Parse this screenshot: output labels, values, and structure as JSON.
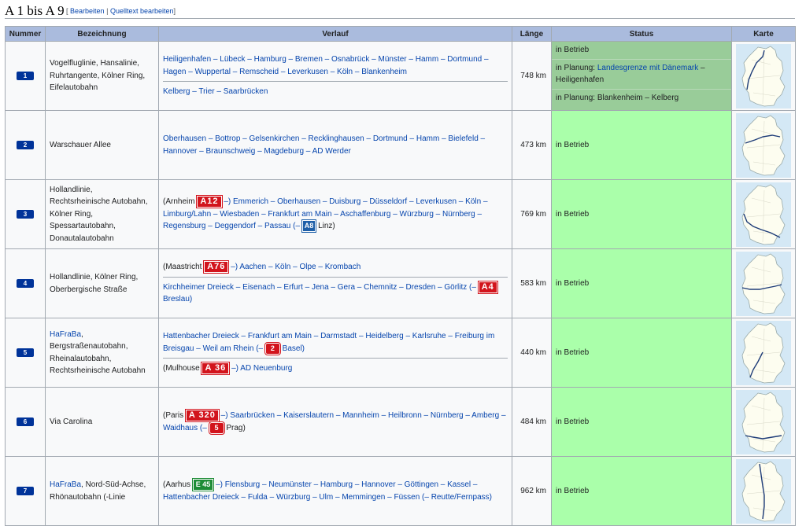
{
  "heading": {
    "title": "A 1 bis A 9",
    "edit_open": "[",
    "edit_label": "Bearbeiten",
    "edit_sep": "|",
    "source_label": "Quelltext bearbeiten",
    "edit_close": "]"
  },
  "columns": {
    "nummer": "Nummer",
    "bezeichnung": "Bezeichnung",
    "verlauf": "Verlauf",
    "laenge": "Länge",
    "status": "Status",
    "karte": "Karte"
  },
  "rows": [
    {
      "nummer": "1",
      "bezeichnung": "Vogelfluglinie, Hansalinie, Ruhrtangente, Kölner Ring, Eifelautobahn",
      "verlauf_1": "Heiligenhafen – Lübeck – Hamburg – Bremen – Osnabrück – Münster – Hamm – Dortmund – Hagen – Wuppertal – Remscheid – Leverkusen – Köln – Blankenheim",
      "verlauf_2": "Kelberg – Trier – Saarbrücken",
      "laenge": "748 km",
      "status_1": "in Betrieb",
      "status_2_prefix": "in Planung: ",
      "status_2_link": "Landesgrenze mit Dänemark",
      "status_2_suffix": " – Heiligenhafen",
      "status_3": "in Planung: Blankenheim – Kelberg"
    },
    {
      "nummer": "2",
      "bezeichnung": "Warschauer Allee",
      "verlauf_1": "Oberhausen – Bottrop – Gelsenkirchen – Recklinghausen – Dortmund – Hamm – Bielefeld – Hannover – Braunschweig – Magdeburg – AD Werder",
      "laenge": "473 km",
      "status_1": "in Betrieb"
    },
    {
      "nummer": "3",
      "bezeichnung": "Hollandlinie, Rechtsrheinische Autobahn, Kölner Ring, Spessartautobahn, Donautalautobahn",
      "verlauf_pre": "(Arnheim ",
      "sign_a": "A12",
      "verlauf_mid": " –) Emmerich – Oberhausen – Duisburg – Düsseldorf – Leverkusen – Köln – Limburg/Lahn – Wiesbaden – Frankfurt am Main – Aschaffenburg – Würzburg – Nürnberg – Regensburg – Deggendorf – Passau (– ",
      "sign_b": "A8",
      "verlauf_post": " Linz)",
      "laenge": "769 km",
      "status_1": "in Betrieb"
    },
    {
      "nummer": "4",
      "bezeichnung": "Hollandlinie, Kölner Ring, Oberbergische Straße",
      "verlauf_1_pre": "(Maastricht ",
      "sign_a": "A76",
      "verlauf_1_post": " –) Aachen – Köln – Olpe – Krombach",
      "verlauf_2_pre": "Kirchheimer Dreieck – Eisenach – Erfurt – Jena – Gera – Chemnitz – Dresden – Görlitz (– ",
      "sign_b": "A4",
      "verlauf_2_post": " Breslau)",
      "laenge": "583 km",
      "status_1": "in Betrieb"
    },
    {
      "nummer": "5",
      "bezeichnung_link": "HaFraBa",
      "bezeichnung": ", Bergstraßenautobahn, Rheinalautobahn, Rechtsrheinische Autobahn",
      "verlauf_1_pre": "Hattenbacher Dreieck – Frankfurt am Main – Darmstadt – Heidelberg – Karlsruhe – Freiburg im Breisgau – Weil am Rhein (– ",
      "sign_a": "2",
      "verlauf_1_post": " Basel)",
      "verlauf_2_pre": "(Mulhouse ",
      "sign_b": "A 36",
      "verlauf_2_post": " –) AD Neuenburg",
      "laenge": "440 km",
      "status_1": "in Betrieb"
    },
    {
      "nummer": "6",
      "bezeichnung": "Via Carolina",
      "verlauf_pre": "(Paris ",
      "sign_a": "A 320",
      "verlauf_mid": " –) Saarbrücken – Kaiserslautern – Mannheim – Heilbronn – Nürnberg – Amberg – Waidhaus (– ",
      "sign_b": "5",
      "verlauf_post": " Prag)",
      "laenge": "484 km",
      "status_1": "in Betrieb"
    },
    {
      "nummer": "7",
      "bezeichnung_link": "HaFraBa",
      "bezeichnung": ", Nord-Süd-Achse, Rhönautobahn (-Linie",
      "verlauf_pre": "(Aarhus ",
      "sign_a": "E 45",
      "verlauf_mid": " –) Flensburg – Neumünster – Hamburg – Hannover – Göttingen – Kassel – Hattenbacher Dreieck – Fulda – Würzburg – Ulm – Memmingen – Füssen (– Reutte/Fernpass)",
      "laenge": "962 km",
      "status_1": "in Betrieb"
    }
  ]
}
